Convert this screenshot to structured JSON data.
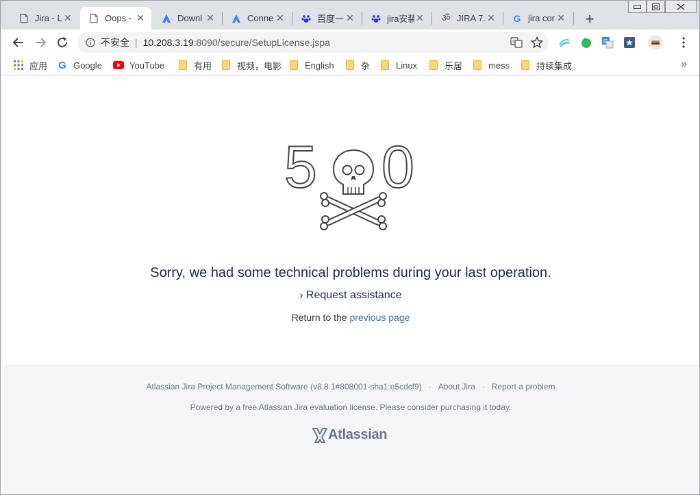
{
  "browser": {
    "tabs": [
      {
        "title": "Jira - Li",
        "icon": "page-icon",
        "active": false
      },
      {
        "title": "Oops -",
        "icon": "page-icon",
        "active": true
      },
      {
        "title": "Downl",
        "icon": "atlassian-icon",
        "active": false
      },
      {
        "title": "Conne",
        "icon": "atlassian-icon",
        "active": false
      },
      {
        "title": "百度一",
        "icon": "baidu-icon",
        "active": false
      },
      {
        "title": "jira安装",
        "icon": "baidu-icon",
        "active": false
      },
      {
        "title": "JIRA 7.",
        "icon": "om-icon",
        "active": false
      },
      {
        "title": "jira cor",
        "icon": "google-icon",
        "active": false
      }
    ],
    "address": {
      "insecure_label": "不安全",
      "host": "10.208.3.19",
      "path": ":8090/secure/SetupLicense.jspa"
    },
    "bookmarks": [
      {
        "label": "应用",
        "icon": "apps-grid-icon"
      },
      {
        "label": "Google",
        "icon": "google-icon"
      },
      {
        "label": "YouTube",
        "icon": "youtube-icon"
      },
      {
        "label": "有用",
        "icon": "folder-icon"
      },
      {
        "label": "视频，电影",
        "icon": "folder-icon"
      },
      {
        "label": "English",
        "icon": "folder-icon"
      },
      {
        "label": "杂",
        "icon": "folder-icon"
      },
      {
        "label": "Linux",
        "icon": "folder-icon"
      },
      {
        "label": "乐居",
        "icon": "folder-icon"
      },
      {
        "label": "mess",
        "icon": "folder-icon"
      },
      {
        "label": "持续集成",
        "icon": "folder-icon"
      }
    ]
  },
  "error": {
    "code_left": "5",
    "code_right": "0",
    "message": "Sorry, we had some technical problems during your last operation.",
    "request_label": "Request assistance",
    "return_prefix": "Return to the ",
    "return_link": "previous page"
  },
  "footer": {
    "version_text": "Atlassian Jira Project Management Software (v8.8.1#808001-sha1:e5cdcf9)",
    "about_label": "About Jira",
    "report_label": "Report a problem",
    "license_text": "Powered by a free Atlassian Jira evaluation license. Please consider purchasing it today.",
    "logo_text": "Atlassian"
  },
  "colors": {
    "link": "#3b73af",
    "footer_bg": "#f4f5f7",
    "tabstrip_bg": "#dee1e6"
  }
}
